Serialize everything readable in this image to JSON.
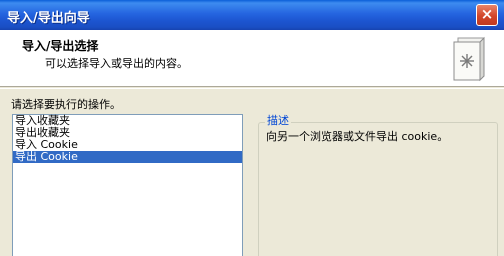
{
  "window": {
    "title": "导入/导出向导",
    "close_label": "×"
  },
  "header": {
    "title": "导入/导出选择",
    "subtitle": "可以选择导入或导出的内容。"
  },
  "main": {
    "prompt": "请选择要执行的操作。",
    "actions": [
      "导入收藏夹",
      "导出收藏夹",
      "导入 Cookie",
      "导出 Cookie"
    ],
    "selected_index": 3,
    "description_legend": "描述",
    "description_text": "向另一个浏览器或文件导出 cookie。"
  },
  "icons": {
    "close": "close-icon",
    "wizard": "wizard-book-icon"
  },
  "colors": {
    "titlebar": "#2565e0",
    "selection": "#316ac5",
    "legend": "#0046d5"
  }
}
